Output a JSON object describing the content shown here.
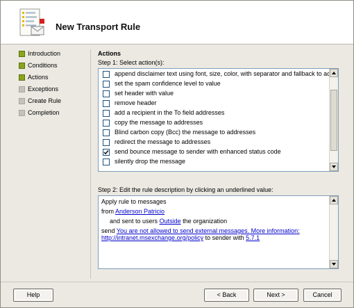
{
  "window": {
    "title": "New Transport Rule"
  },
  "steps": [
    {
      "label": "Introduction",
      "done": true
    },
    {
      "label": "Conditions",
      "done": true
    },
    {
      "label": "Actions",
      "done": true
    },
    {
      "label": "Exceptions",
      "done": false
    },
    {
      "label": "Create Rule",
      "done": false
    },
    {
      "label": "Completion",
      "done": false
    }
  ],
  "actions": {
    "heading": "Actions",
    "step1_label": "Step 1: Select action(s):",
    "items": [
      {
        "label": "append disclaimer text using font, size, color, with separator and fallback to action if",
        "checked": false
      },
      {
        "label": "set the spam confidence level to value",
        "checked": false
      },
      {
        "label": "set header with value",
        "checked": false
      },
      {
        "label": "remove header",
        "checked": false
      },
      {
        "label": "add a recipient in the To field addresses",
        "checked": false
      },
      {
        "label": "copy the message to addresses",
        "checked": false
      },
      {
        "label": "Blind carbon copy (Bcc) the message to addresses",
        "checked": false
      },
      {
        "label": "redirect the message to addresses",
        "checked": false
      },
      {
        "label": "send bounce message to sender with enhanced status code",
        "checked": true
      },
      {
        "label": "silently drop the message",
        "checked": false
      }
    ],
    "step2_label": "Step 2: Edit the rule description by clicking an underlined value:"
  },
  "description": {
    "line1": "Apply rule to messages",
    "from_prefix": "from",
    "from_link": "Anderson Patricio",
    "sent_prefix": "and sent to users",
    "sent_link": "Outside",
    "sent_suffix": "the organization",
    "send_prefix": "send",
    "send_link_line1": "You are not allowed to send external messages. More information:",
    "send_link_line2": "http://intranet.msexchange.org/policy",
    "send_mid": "to sender with",
    "code_link": "5.7.1"
  },
  "buttons": {
    "help": "Help",
    "back": "< Back",
    "next": "Next >",
    "cancel": "Cancel"
  }
}
